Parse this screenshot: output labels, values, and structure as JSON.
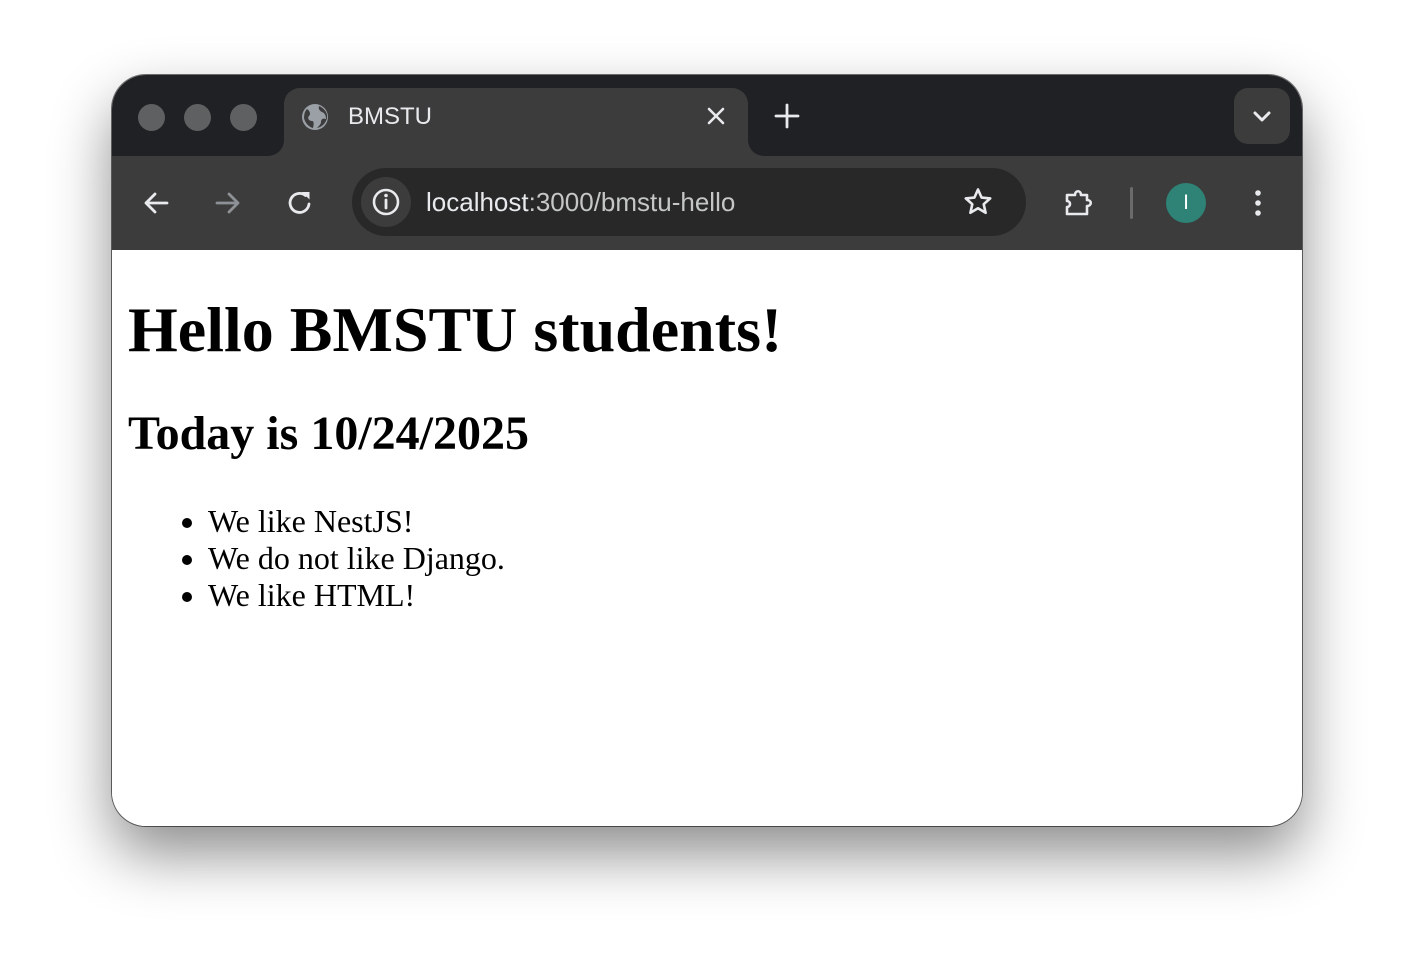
{
  "browser": {
    "tab": {
      "title": "BMSTU",
      "favicon": "globe-icon"
    },
    "toolbar": {
      "url_host": "localhost",
      "url_path": ":3000/bmstu-hello",
      "profile_initial": "I",
      "profile_color": "#2e8376"
    },
    "colors": {
      "titlebar": "#202124",
      "toolbar": "#3c3c3c",
      "omnibox": "#282828"
    }
  },
  "page": {
    "heading": "Hello BMSTU students!",
    "subheading": "Today is 10/24/2025",
    "items": [
      "We like NestJS!",
      "We do not like Django.",
      "We like HTML!"
    ]
  }
}
